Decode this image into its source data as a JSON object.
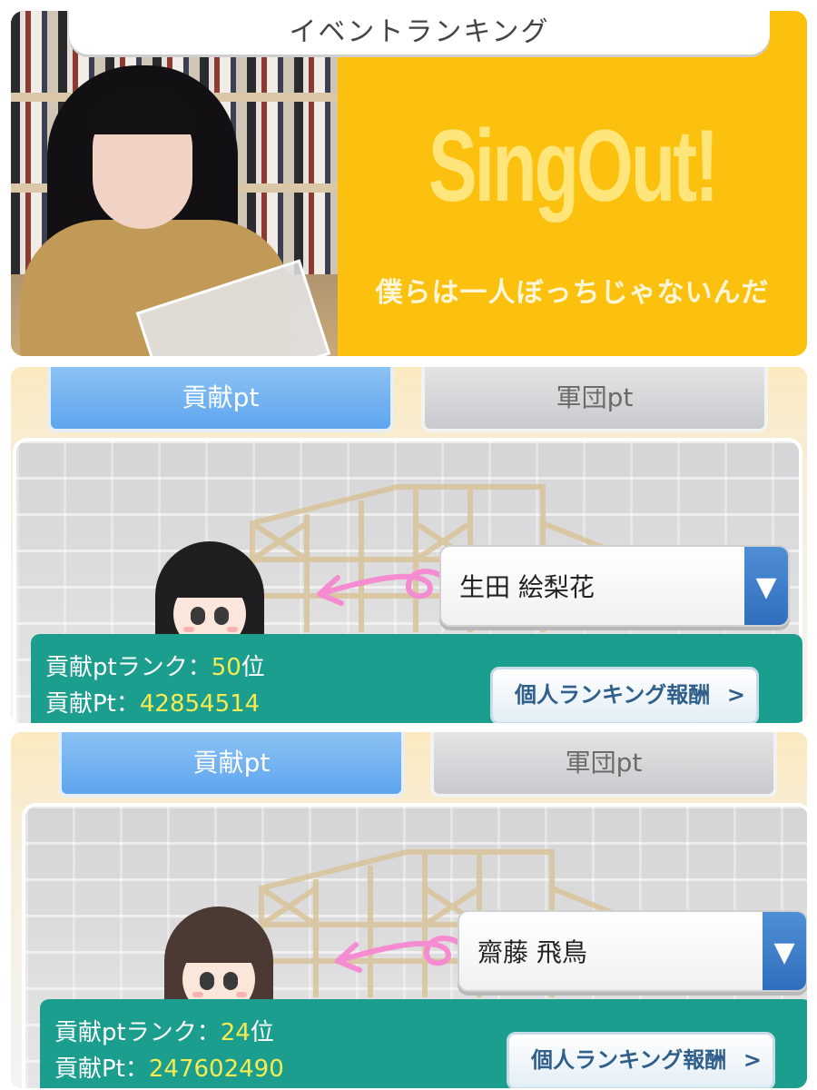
{
  "header": {
    "title": "イベントランキング"
  },
  "banner": {
    "title": "SingOut!",
    "subtitle": "僕らは一人ぼっちじゃないんだ"
  },
  "panels": [
    {
      "tabs": [
        "貢献pt",
        "軍団pt"
      ],
      "active_tab": 0,
      "selected_member": "生田 絵梨花",
      "rank_label": "貢献ptランク：",
      "rank_value": "50",
      "rank_suffix": "位",
      "points_label": "貢献Pt：",
      "points_value": "42854514",
      "reward_button": "個人ランキング報酬",
      "avatar_hair_color": "#1f1f22"
    },
    {
      "tabs": [
        "貢献pt",
        "軍団pt"
      ],
      "active_tab": 0,
      "selected_member": "齋藤 飛鳥",
      "rank_label": "貢献ptランク：",
      "rank_value": "24",
      "rank_suffix": "位",
      "points_label": "貢献Pt：",
      "points_value": "247602490",
      "reward_button": "個人ランキング報酬",
      "avatar_hair_color": "#4a3a33"
    }
  ],
  "colors": {
    "banner_yellow": "#fcc10e",
    "tab_active": "#5ea5ee",
    "info_bar": "#1c9e8e",
    "value_highlight": "#f4ec52",
    "select_button": "#2e6dbb"
  }
}
